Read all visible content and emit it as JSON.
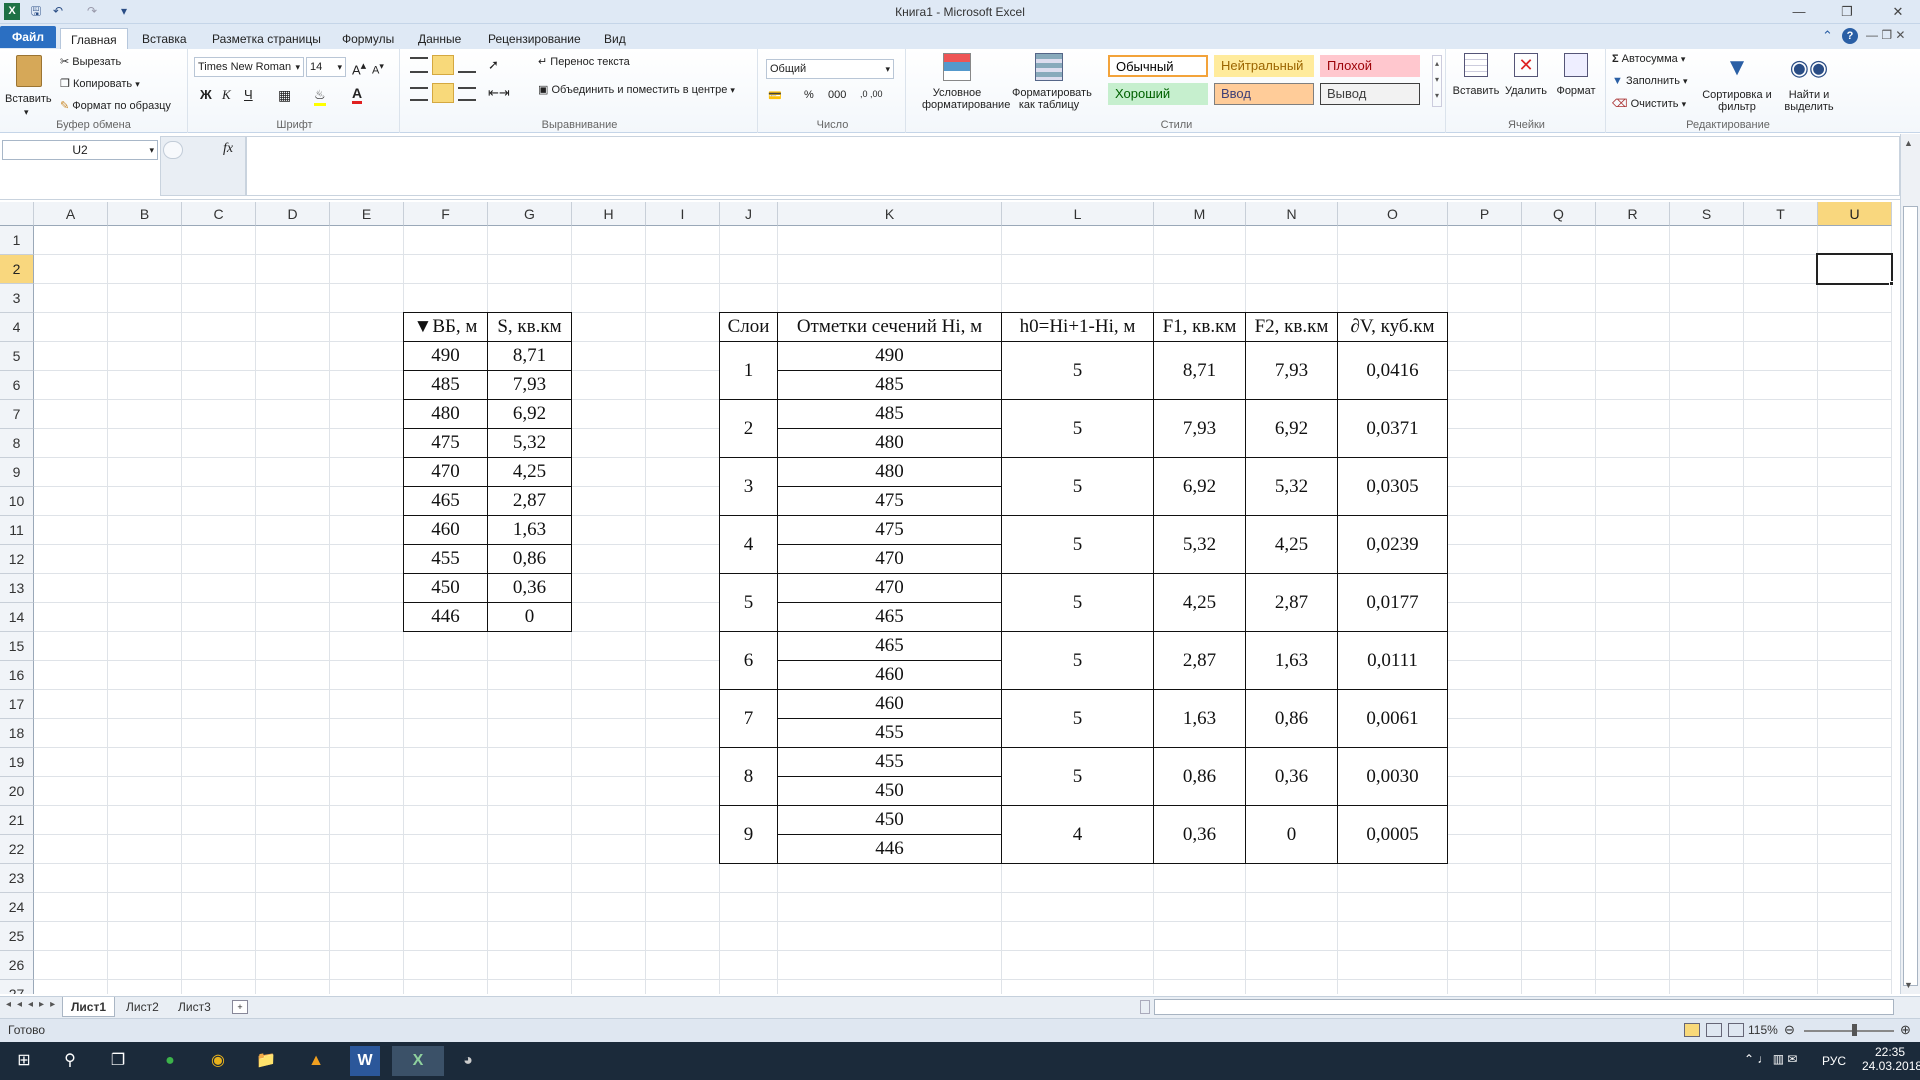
{
  "window": {
    "title": "Книга1 - Microsoft Excel"
  },
  "ribbon_tabs": [
    "Файл",
    "Главная",
    "Вставка",
    "Разметка страницы",
    "Формулы",
    "Данные",
    "Рецензирование",
    "Вид"
  ],
  "clipboard": {
    "paste": "Вставить",
    "cut": "Вырезать",
    "copy": "Копировать",
    "format_painter": "Формат по образцу",
    "label": "Буфер обмена"
  },
  "font": {
    "name": "Times New Roman",
    "size": "14",
    "label": "Шрифт",
    "bold": "Ж",
    "italic": "К",
    "underline": "Ч"
  },
  "alignment": {
    "wrap": "Перенос текста",
    "merge": "Объединить и поместить в центре",
    "label": "Выравнивание"
  },
  "number": {
    "format": "Общий",
    "label": "Число",
    "percent": "%",
    "thousands": "000"
  },
  "styles": {
    "conditional": "Условное форматирование",
    "as_table": "Форматировать как таблицу",
    "label": "Стили",
    "cells": [
      {
        "t": "Обычный",
        "bg": "#ffffff",
        "fg": "#000000",
        "bd": "#f3a33a"
      },
      {
        "t": "Нейтральный",
        "bg": "#ffeb9c",
        "fg": "#9c6500",
        "bd": "#ffeb9c"
      },
      {
        "t": "Плохой",
        "bg": "#ffc7ce",
        "fg": "#9c0006",
        "bd": "#ffc7ce"
      },
      {
        "t": "Хороший",
        "bg": "#c6efce",
        "fg": "#006100",
        "bd": "#c6efce"
      },
      {
        "t": "Ввод",
        "bg": "#ffcc99",
        "fg": "#3f3f76",
        "bd": "#7f7f7f"
      },
      {
        "t": "Вывод",
        "bg": "#f2f2f2",
        "fg": "#3f3f3f",
        "bd": "#3f3f3f"
      }
    ]
  },
  "cells_grp": {
    "insert": "Вставить",
    "delete": "Удалить",
    "format": "Формат",
    "label": "Ячейки"
  },
  "editing": {
    "autosum": "Автосумма",
    "fill": "Заполнить",
    "clear": "Очистить",
    "sort": "Сортировка и фильтр",
    "find": "Найти и выделить",
    "label": "Редактирование"
  },
  "namebox": "U2",
  "fx": "fx",
  "columns": [
    "A",
    "B",
    "C",
    "D",
    "E",
    "F",
    "G",
    "H",
    "I",
    "J",
    "K",
    "L",
    "M",
    "N",
    "O",
    "P",
    "Q",
    "R",
    "S",
    "T",
    "U"
  ],
  "rows": [
    "1",
    "2",
    "3",
    "4",
    "5",
    "6",
    "7",
    "8",
    "9",
    "10",
    "11",
    "12",
    "13",
    "14",
    "15",
    "16",
    "17",
    "18",
    "19",
    "20",
    "21",
    "22",
    "23",
    "24",
    "25",
    "26",
    "27"
  ],
  "selected": {
    "col": "U",
    "row": "2"
  },
  "table1": {
    "headers": [
      "▼ВБ, м",
      "S, кв.км"
    ],
    "rows": [
      [
        "490",
        "8,71"
      ],
      [
        "485",
        "7,93"
      ],
      [
        "480",
        "6,92"
      ],
      [
        "475",
        "5,32"
      ],
      [
        "470",
        "4,25"
      ],
      [
        "465",
        "2,87"
      ],
      [
        "460",
        "1,63"
      ],
      [
        "455",
        "0,86"
      ],
      [
        "450",
        "0,36"
      ],
      [
        "446",
        "0"
      ]
    ]
  },
  "table2": {
    "headers": [
      "Слои",
      "Отметки сечений Hi, м",
      "h0=Hi+1-Hi, м",
      "F1, кв.км",
      "F2, кв.км",
      "∂V, куб.км"
    ],
    "layers": [
      {
        "n": "1",
        "h1": "490",
        "h2": "485",
        "h0": "5",
        "f1": "8,71",
        "f2": "7,93",
        "dv": "0,0416"
      },
      {
        "n": "2",
        "h1": "485",
        "h2": "480",
        "h0": "5",
        "f1": "7,93",
        "f2": "6,92",
        "dv": "0,0371"
      },
      {
        "n": "3",
        "h1": "480",
        "h2": "475",
        "h0": "5",
        "f1": "6,92",
        "f2": "5,32",
        "dv": "0,0305"
      },
      {
        "n": "4",
        "h1": "475",
        "h2": "470",
        "h0": "5",
        "f1": "5,32",
        "f2": "4,25",
        "dv": "0,0239"
      },
      {
        "n": "5",
        "h1": "470",
        "h2": "465",
        "h0": "5",
        "f1": "4,25",
        "f2": "2,87",
        "dv": "0,0177"
      },
      {
        "n": "6",
        "h1": "465",
        "h2": "460",
        "h0": "5",
        "f1": "2,87",
        "f2": "1,63",
        "dv": "0,0111"
      },
      {
        "n": "7",
        "h1": "460",
        "h2": "455",
        "h0": "5",
        "f1": "1,63",
        "f2": "0,86",
        "dv": "0,0061"
      },
      {
        "n": "8",
        "h1": "455",
        "h2": "450",
        "h0": "5",
        "f1": "0,86",
        "f2": "0,36",
        "dv": "0,0030"
      },
      {
        "n": "9",
        "h1": "450",
        "h2": "446",
        "h0": "4",
        "f1": "0,36",
        "f2": "0",
        "dv": "0,0005"
      }
    ]
  },
  "sheets": [
    "Лист1",
    "Лист2",
    "Лист3"
  ],
  "status": {
    "ready": "Готово",
    "zoom": "115%"
  },
  "taskbar": {
    "lang": "РУС",
    "time": "22:35",
    "date": "24.03.2018"
  }
}
